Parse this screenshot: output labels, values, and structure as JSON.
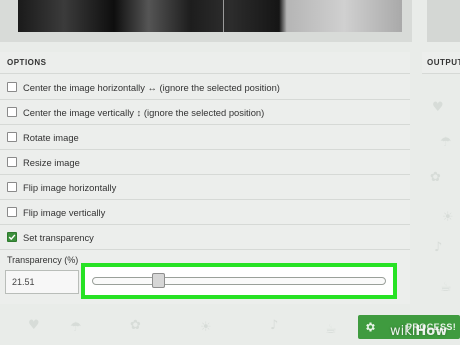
{
  "panels": {
    "options_title": "OPTIONS",
    "output_title": "OUTPUT"
  },
  "options": [
    {
      "label": "Center the image horizontally ↔ (ignore the selected position)",
      "checked": false
    },
    {
      "label": "Center the image vertically ↕ (ignore the selected position)",
      "checked": false
    },
    {
      "label": "Rotate image",
      "checked": false
    },
    {
      "label": "Resize image",
      "checked": false
    },
    {
      "label": "Flip image horizontally",
      "checked": false
    },
    {
      "label": "Flip image vertically",
      "checked": false
    },
    {
      "label": "Set transparency",
      "checked": true
    }
  ],
  "transparency": {
    "label": "Transparency (%)",
    "value": "21.51",
    "slider_percent": 21.51
  },
  "process_button": {
    "label": "PROCESS!",
    "icon": "gear-icon"
  },
  "watermark": {
    "wiki": "wiki",
    "how": "How"
  },
  "colors": {
    "highlight": "#27e224",
    "process_green": "#3f9b3f",
    "checkbox_green": "#3c8f3c"
  }
}
